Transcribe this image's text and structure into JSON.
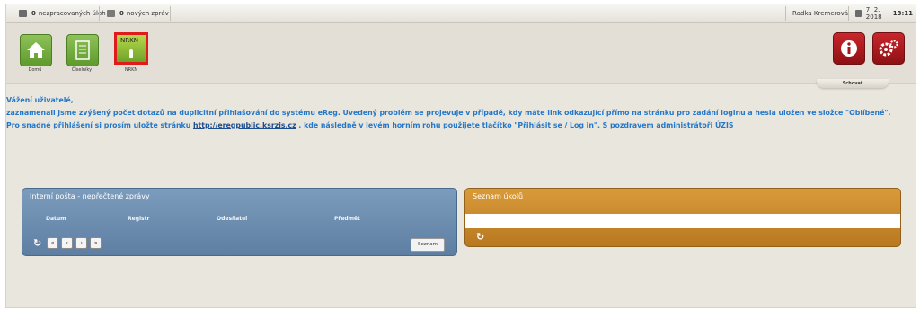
{
  "topbar": {
    "tasks_count": "0",
    "tasks_label": "nezpracovaných úloh",
    "messages_count": "0",
    "messages_label": "nových zpráv",
    "user": "Radka Kremerová",
    "date": "7. 2. 2018",
    "time": "13:11"
  },
  "toolbar": {
    "home_label": "Domů",
    "codebooks_label": "Číselníky",
    "nrkn_tile_text": "NRKN",
    "nrkn_label": "NRKN",
    "hide_label": "Schovat"
  },
  "message": {
    "line1": "Vážení uživatelé,",
    "line2": "zaznamenali jsme zvýšený počet dotazů na duplicitní přihlašování do systému eReg. Uvedený problém se projevuje v případě, kdy máte link odkazující přímo na stránku pro zadání loginu a hesla uložen ve složce \"Oblíbené\".",
    "line3_before": "Pro snadné přihlášení si prosím uložte stránku",
    "line3_link": "http://eregpublic.ksrzis.cz",
    "line3_after": ", kde následně v levém horním rohu použijete tlačítko \"Přihlásit se / Log in\". S pozdravem administrátoři ÚZIS"
  },
  "mail_panel": {
    "title": "Interní pošta - nepřečtené zprávy",
    "columns": [
      "Datum",
      "Registr",
      "Odesílatel",
      "Předmět"
    ],
    "button_label": "Seznam"
  },
  "tasks_panel": {
    "title": "Seznam úkolů"
  },
  "colors": {
    "message_text": "#2577c8",
    "link": "#1f4e8f",
    "mail_panel": "#6f8fb2",
    "tasks_panel": "#c98a2c",
    "nrkn_highlight": "#e01b1b"
  }
}
